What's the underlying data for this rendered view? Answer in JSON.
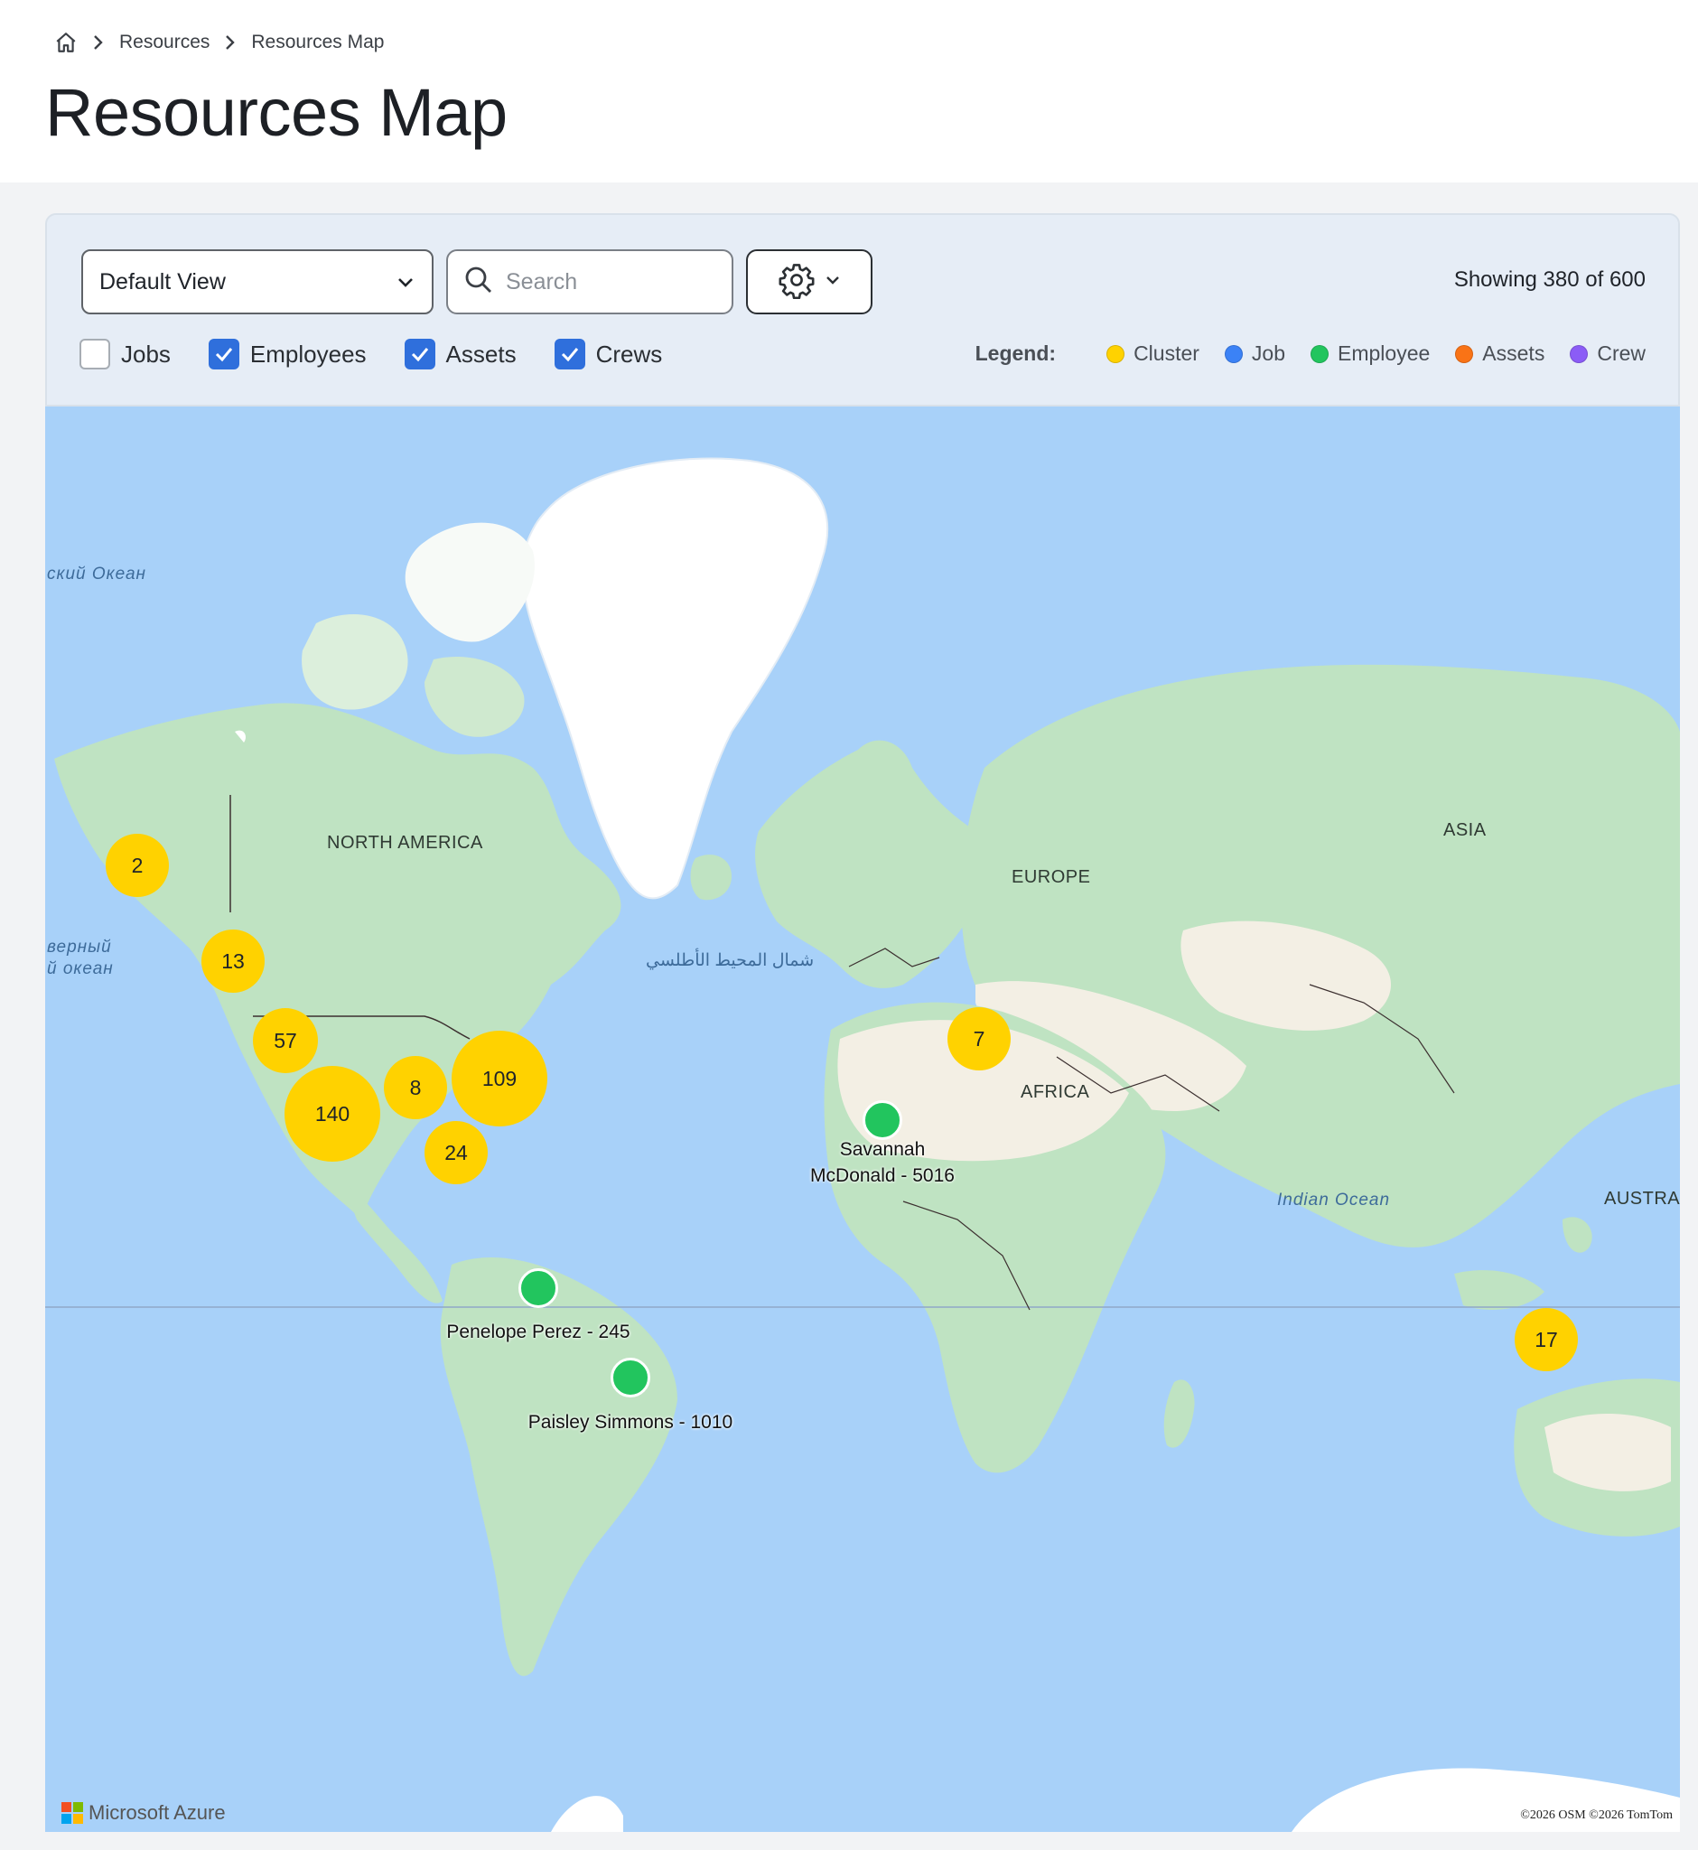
{
  "breadcrumb": {
    "items": [
      "Resources",
      "Resources Map"
    ]
  },
  "page": {
    "title": "Resources Map"
  },
  "toolbar": {
    "view_select": "Default View",
    "search_placeholder": "Search",
    "showing": "Showing 380 of 600",
    "filters": [
      {
        "label": "Jobs",
        "checked": false
      },
      {
        "label": "Employees",
        "checked": true
      },
      {
        "label": "Assets",
        "checked": true
      },
      {
        "label": "Crews",
        "checked": true
      }
    ]
  },
  "legend": {
    "title": "Legend:",
    "items": [
      {
        "label": "Cluster",
        "color": "#ffd200"
      },
      {
        "label": "Job",
        "color": "#3b82f6"
      },
      {
        "label": "Employee",
        "color": "#22c55e"
      },
      {
        "label": "Assets",
        "color": "#f97316"
      },
      {
        "label": "Crew",
        "color": "#8b5cf6"
      }
    ]
  },
  "map": {
    "ocean_labels": {
      "arctic": "ский Океан",
      "pacific_line1": "верный",
      "pacific_line2": "й океан",
      "atlantic": "شمال المحيط الأطلسي",
      "indian": "Indian Ocean"
    },
    "region_labels": {
      "north_america": "NORTH AMERICA",
      "europe": "EUROPE",
      "asia": "ASIA",
      "africa": "AFRICA",
      "australia": "AUSTRAL"
    },
    "clusters": [
      "2",
      "13",
      "57",
      "140",
      "8",
      "109",
      "24",
      "7",
      "17"
    ],
    "employees": {
      "savannah_line1": "Savannah",
      "savannah_line2": "McDonald - 5016",
      "penelope": "Penelope Perez - 245",
      "paisley": "Paisley Simmons - 1010"
    },
    "logo_text": "Microsoft Azure",
    "attribution": "©2026 OSM  ©2026 TomTom",
    "colors": {
      "ocean": "#a8d1f9",
      "land": "#bfe3c2",
      "desert": "#f3efe4",
      "ice": "#ffffff"
    }
  }
}
